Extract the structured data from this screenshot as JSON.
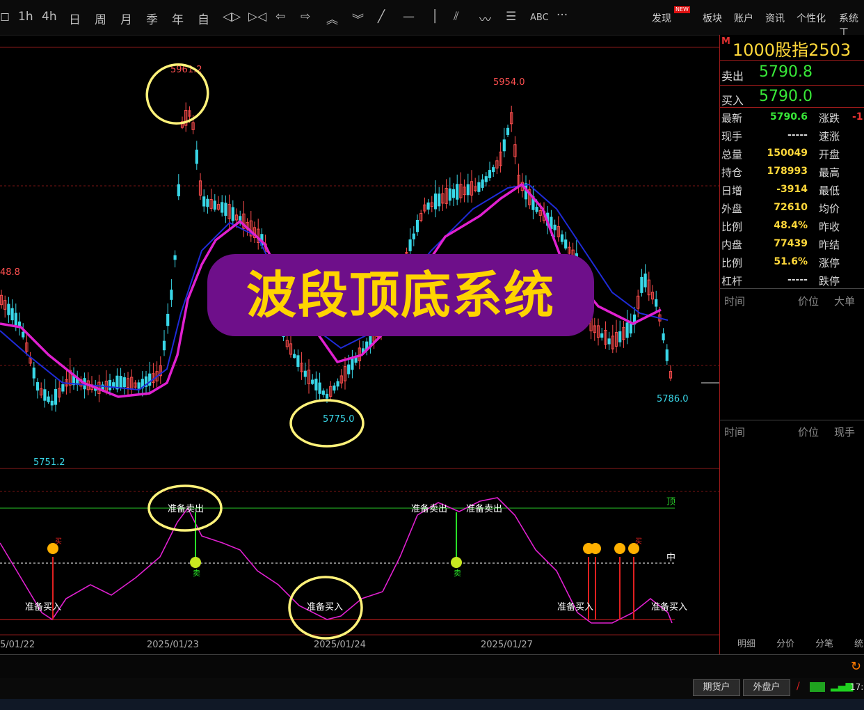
{
  "toolbar": {
    "periods": [
      "1h",
      "4h",
      "日",
      "周",
      "月",
      "季",
      "年",
      "自"
    ],
    "abc_label": "ABC",
    "more_label": "···",
    "menu": [
      "发现",
      "板块",
      "账户",
      "资讯",
      "个性化",
      "系统工"
    ],
    "new_badge": "NEW"
  },
  "chart": {
    "high_label": "5961.2",
    "peak_label": "5954.0",
    "left_label": "48.8",
    "low_label": "5751.2",
    "mid_low_label": "5775.0",
    "last_label": "5786.0",
    "top_label": "顶",
    "mid_label": "中",
    "sell_prep": [
      "准备卖出",
      "准备卖出",
      "准备卖出"
    ],
    "buy_prep": [
      "准备买入",
      "准备买入",
      "准备买入",
      "准备买入"
    ],
    "sell_marks": [
      "卖",
      "卖"
    ],
    "buy_marks": [
      "买",
      "买"
    ],
    "dates": [
      "5/01/22",
      "2025/01/23",
      "2025/01/24",
      "2025/01/27"
    ],
    "colors": {
      "up": "#ff4d4d",
      "down": "#39d7e8",
      "ma1": "#1f2bd8",
      "ma2": "#e020d0",
      "osc": "#e020d0",
      "top_line": "#28c828",
      "banner_bg": "#6e0f8a",
      "banner_text": "#ffd400",
      "circle": "#fff27a"
    }
  },
  "banner": {
    "text": "波段顶底系统"
  },
  "quote_panel": {
    "market_flag": "M",
    "title": "1000股指2503",
    "sell_label": "卖出",
    "sell_price": "5790.8",
    "buy_label": "买入",
    "buy_price": "5790.0",
    "rows": [
      {
        "label": "最新",
        "value": "5790.6",
        "color": "#38e838",
        "label2": "涨跌",
        "value2": "-1"
      },
      {
        "label": "现手",
        "value": "-----",
        "color": "#d8d8d8",
        "label2": "速涨",
        "value2": ""
      },
      {
        "label": "总量",
        "value": "150049",
        "color": "#ffd83a",
        "label2": "开盘",
        "value2": ""
      },
      {
        "label": "持仓",
        "value": "178993",
        "color": "#ffd83a",
        "label2": "最高",
        "value2": ""
      },
      {
        "label": "日增",
        "value": "-3914",
        "color": "#ffd83a",
        "label2": "最低",
        "value2": ""
      },
      {
        "label": "外盘",
        "value": "72610",
        "color": "#ffd83a",
        "label2": "均价",
        "value2": ""
      },
      {
        "label": "比例",
        "value": "48.4%",
        "color": "#ffd83a",
        "label2": "昨收",
        "value2": ""
      },
      {
        "label": "内盘",
        "value": "77439",
        "color": "#ffd83a",
        "label2": "昨结",
        "value2": ""
      },
      {
        "label": "比例",
        "value": "51.6%",
        "color": "#ffd83a",
        "label2": "涨停",
        "value2": ""
      },
      {
        "label": "杠杆",
        "value": "-----",
        "color": "#d8d8d8",
        "label2": "跌停",
        "value2": ""
      }
    ],
    "tick_header": [
      "时间",
      "价位",
      "大单"
    ],
    "trade_header": [
      "时间",
      "价位",
      "现手"
    ],
    "tabs": [
      "明细",
      "分价",
      "分笔",
      "统"
    ]
  },
  "status": {
    "accounts": [
      "期货户",
      "外盘户"
    ],
    "time": "17:"
  }
}
